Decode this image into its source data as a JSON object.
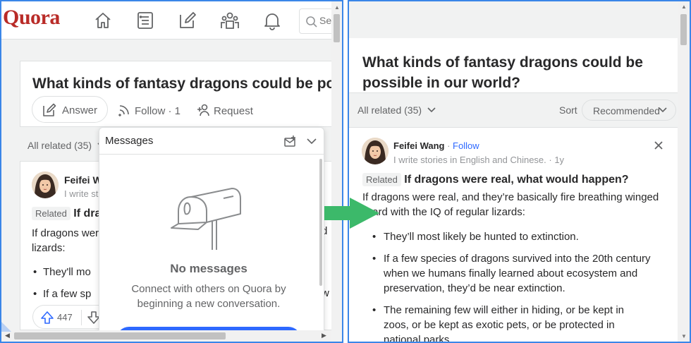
{
  "left": {
    "logo": "Quora",
    "search_placeholder": "Se",
    "question_title": "What kinds of fantasy dragons could be po",
    "answer_label": "Answer",
    "follow_label": "Follow · 1",
    "request_label": "Request",
    "all_related": "All related (35)",
    "author_name": "Feifei W",
    "author_cred": "I write st",
    "related_tag": "Related",
    "related_title": "If dra",
    "body_line1": "If dragons wer",
    "body_line2": "lizards:",
    "bullet1": "They'll mo",
    "bullet2": "If a few sp",
    "right_frag1": "d",
    "right_frag2": "w",
    "upvote_count": "447",
    "messages": {
      "title": "Messages",
      "empty_title": "No messages",
      "empty_sub": "Connect with others on Quora by beginning a new conversation."
    }
  },
  "right": {
    "question_title": "What kinds of fantasy dragons could be possible in our world?",
    "all_related": "All related (35)",
    "sort_label": "Sort",
    "sort_value": "Recommended",
    "author_name": "Feifei Wang",
    "dot": " · ",
    "follow": "Follow",
    "author_cred": "I write stories in English and Chinese. · 1y",
    "related_tag": "Related",
    "related_title": "If dragons were real, what would happen?",
    "body": "If dragons were real, and they’re basically fire breathing winged lizard with the IQ of regular lizards:",
    "bullets": [
      "They’ll most likely be hunted to extinction.",
      "If a few species of dragons survived into the 20th century when we humans finally learned about ecosystem and preservation, they’d be near extinction.",
      "The remaining few will either in hiding, or be kept in zoos, or be kept as exotic pets, or be protected in national parks."
    ]
  },
  "colors": {
    "brand": "#b92b27",
    "border_blue": "#3a86e8",
    "arrow_green": "#3cb96a",
    "link_blue": "#2e69ff"
  }
}
